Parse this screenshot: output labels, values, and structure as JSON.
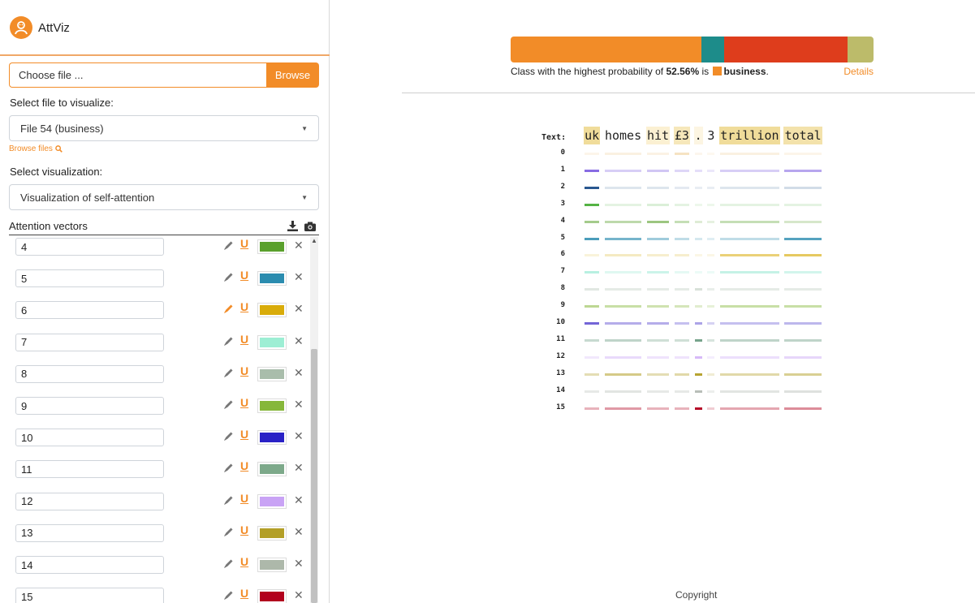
{
  "app": {
    "title": "AttViz"
  },
  "file_input": {
    "placeholder": "Choose file ...",
    "button": "Browse"
  },
  "file_select": {
    "label": "Select file to visualize:",
    "value": "File 54 (business)",
    "browse_link": "Browse files"
  },
  "viz_select": {
    "label": "Select visualization:",
    "value": "Visualization of self-attention"
  },
  "attention": {
    "title": "Attention vectors",
    "vectors": [
      {
        "label": "4",
        "color": "#5aa02c"
      },
      {
        "label": "5",
        "color": "#2b8caf"
      },
      {
        "label": "6",
        "color": "#d9ac0a"
      },
      {
        "label": "7",
        "color": "#9deed4"
      },
      {
        "label": "8",
        "color": "#a9bdab"
      },
      {
        "label": "9",
        "color": "#86b73a"
      },
      {
        "label": "10",
        "color": "#2a22c6"
      },
      {
        "label": "11",
        "color": "#7da98a"
      },
      {
        "label": "12",
        "color": "#c9a3f5"
      },
      {
        "label": "13",
        "color": "#b39f27"
      },
      {
        "label": "14",
        "color": "#adb8aa"
      },
      {
        "label": "15",
        "color": "#b2001d"
      }
    ]
  },
  "prediction": {
    "prefix": "Class with the highest probability of ",
    "probability": "52.56%",
    "mid": " is ",
    "class_name": "business",
    "suffix": ".",
    "details": "Details",
    "segments": [
      {
        "fraction": 0.5256,
        "color": "#f28c28"
      },
      {
        "fraction": 0.0625,
        "color": "#1d8c8a"
      },
      {
        "fraction": 0.34,
        "color": "#de3d1c"
      },
      {
        "fraction": 0.0719,
        "color": "#bcbb6a"
      }
    ]
  },
  "visualization": {
    "text_label": "Text:",
    "tokens": [
      {
        "text": "uk",
        "shade": "#f0dc9a"
      },
      {
        "text": "homes",
        "shade": "#ffffff"
      },
      {
        "text": "hit",
        "shade": "#fbf0d2"
      },
      {
        "text": "£3",
        "shade": "#f6e7ba"
      },
      {
        "text": ".",
        "shade": "#fcf5e2"
      },
      {
        "text": "3",
        "shade": "#ffffff"
      },
      {
        "text": "trillion",
        "shade": "#f0dc9a"
      },
      {
        "text": "total",
        "shade": "#f3e2ab"
      }
    ],
    "rows": [
      {
        "label": "0",
        "color": "#e8b96a",
        "weights": [
          0.15,
          0.2,
          0.18,
          0.4,
          0.12,
          0.1,
          0.2,
          0.15
        ]
      },
      {
        "label": "1",
        "color": "#7b5ce0",
        "weights": [
          0.9,
          0.3,
          0.35,
          0.25,
          0.2,
          0.15,
          0.3,
          0.55
        ]
      },
      {
        "label": "2",
        "color": "#1d4e89",
        "weights": [
          0.95,
          0.15,
          0.15,
          0.12,
          0.1,
          0.1,
          0.15,
          0.2
        ]
      },
      {
        "label": "3",
        "color": "#4caf3a",
        "weights": [
          0.95,
          0.15,
          0.2,
          0.15,
          0.1,
          0.1,
          0.15,
          0.15
        ]
      },
      {
        "label": "4",
        "color": "#5aa02c",
        "weights": [
          0.55,
          0.4,
          0.6,
          0.35,
          0.2,
          0.15,
          0.35,
          0.25
        ]
      },
      {
        "label": "5",
        "color": "#2b8caf",
        "weights": [
          0.85,
          0.65,
          0.45,
          0.3,
          0.2,
          0.15,
          0.3,
          0.8
        ]
      },
      {
        "label": "6",
        "color": "#d9ac0a",
        "weights": [
          0.15,
          0.25,
          0.2,
          0.2,
          0.1,
          0.1,
          0.55,
          0.65
        ]
      },
      {
        "label": "7",
        "color": "#7ee3c8",
        "weights": [
          0.55,
          0.25,
          0.4,
          0.2,
          0.15,
          0.15,
          0.45,
          0.35
        ]
      },
      {
        "label": "8",
        "color": "#a9bdab",
        "weights": [
          0.35,
          0.3,
          0.3,
          0.3,
          0.45,
          0.25,
          0.3,
          0.3
        ]
      },
      {
        "label": "9",
        "color": "#86b73a",
        "weights": [
          0.55,
          0.45,
          0.4,
          0.35,
          0.25,
          0.2,
          0.45,
          0.45
        ]
      },
      {
        "label": "10",
        "color": "#5a4ad0",
        "weights": [
          0.85,
          0.45,
          0.45,
          0.35,
          0.5,
          0.25,
          0.35,
          0.4
        ]
      },
      {
        "label": "11",
        "color": "#5f9478",
        "weights": [
          0.35,
          0.4,
          0.3,
          0.3,
          0.85,
          0.25,
          0.4,
          0.4
        ]
      },
      {
        "label": "12",
        "color": "#c9a3f5",
        "weights": [
          0.25,
          0.4,
          0.3,
          0.3,
          0.75,
          0.2,
          0.35,
          0.45
        ]
      },
      {
        "label": "13",
        "color": "#b39f27",
        "weights": [
          0.35,
          0.55,
          0.35,
          0.4,
          0.95,
          0.2,
          0.4,
          0.5
        ]
      },
      {
        "label": "14",
        "color": "#a0a8a0",
        "weights": [
          0.25,
          0.3,
          0.25,
          0.25,
          0.75,
          0.2,
          0.3,
          0.35
        ]
      },
      {
        "label": "15",
        "color": "#b2001d",
        "weights": [
          0.3,
          0.4,
          0.3,
          0.3,
          0.95,
          0.2,
          0.35,
          0.45
        ]
      }
    ]
  },
  "footer": {
    "copyright": "Copyright"
  }
}
